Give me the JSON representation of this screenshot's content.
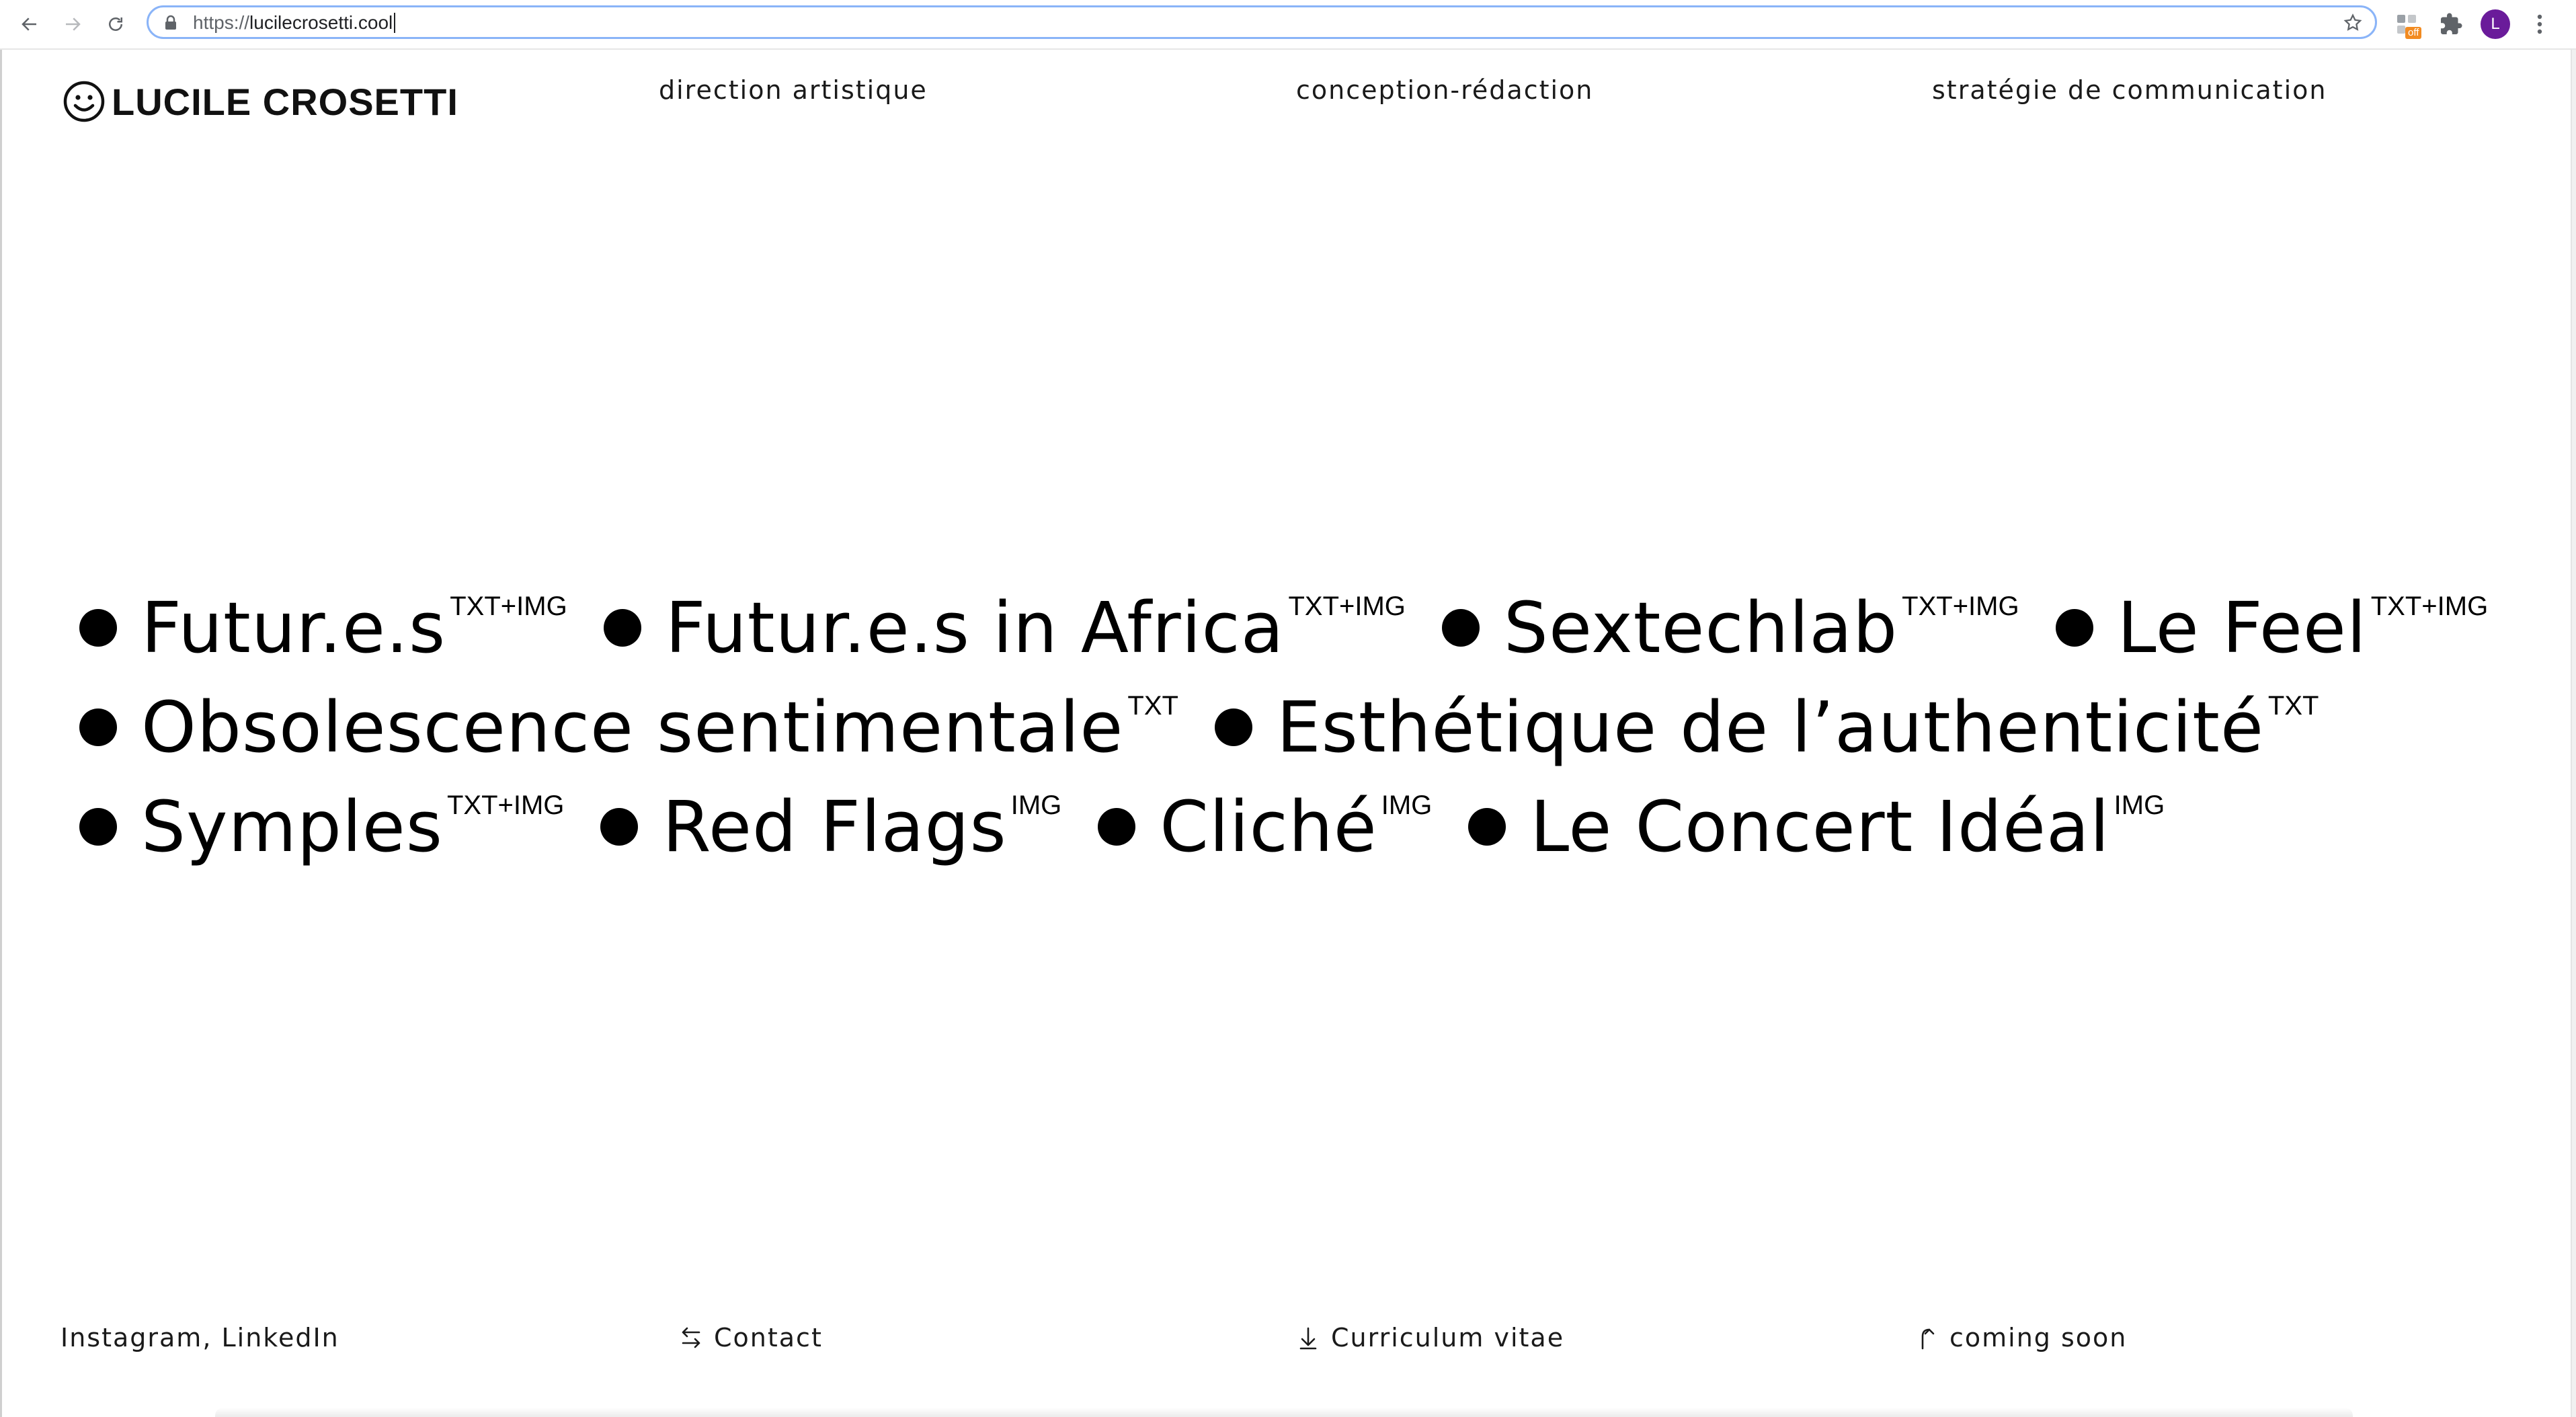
{
  "browser": {
    "url_scheme": "https://",
    "url_host": "lucilecrosetti.cool",
    "extension_badge": "off",
    "profile_initial": "L",
    "icons": {
      "back": "arrow-left-icon",
      "forward": "arrow-right-icon",
      "reload": "reload-icon",
      "lock": "lock-icon",
      "bookmark": "star-icon",
      "extension": "extension-icon",
      "extensions_menu": "puzzle-icon",
      "menu": "kebab-menu-icon"
    },
    "colors": {
      "omnibox_focus": "#8ab4f8",
      "avatar": "#6a1b9a",
      "badge": "#f28b21"
    }
  },
  "site": {
    "logo_text": "LUCILE CROSETTI",
    "logo_icon": "smiley-icon",
    "nav": [
      {
        "label": "direction artistique"
      },
      {
        "label": "conception-rédaction"
      },
      {
        "label": "stratégie de communication"
      }
    ],
    "project_rows": [
      [
        {
          "title": "Futur.e.s",
          "tag": "TXT+IMG"
        },
        {
          "title": "Futur.e.s in Africa",
          "tag": "TXT+IMG"
        },
        {
          "title": "Sextechlab",
          "tag": "TXT+IMG"
        },
        {
          "title": "Le Feel",
          "tag": "TXT+IMG"
        }
      ],
      [
        {
          "title": "Obsolescence sentimentale",
          "tag": "TXT"
        },
        {
          "title": "Esthétique de l’authenticité",
          "tag": "TXT"
        }
      ],
      [
        {
          "title": "Symples",
          "tag": "TXT+IMG"
        },
        {
          "title": "Red Flags",
          "tag": "IMG"
        },
        {
          "title": "Cliché",
          "tag": "IMG"
        },
        {
          "title": "Le Concert Idéal",
          "tag": "IMG"
        }
      ]
    ],
    "footer": {
      "social": "Instagram, LinkedIn",
      "contact": "Contact",
      "contact_icon": "swap-arrows-icon",
      "cv": "Curriculum vitae",
      "cv_icon": "download-arrow-icon",
      "soon": "coming soon",
      "soon_icon": "curved-up-arrow-icon"
    }
  }
}
